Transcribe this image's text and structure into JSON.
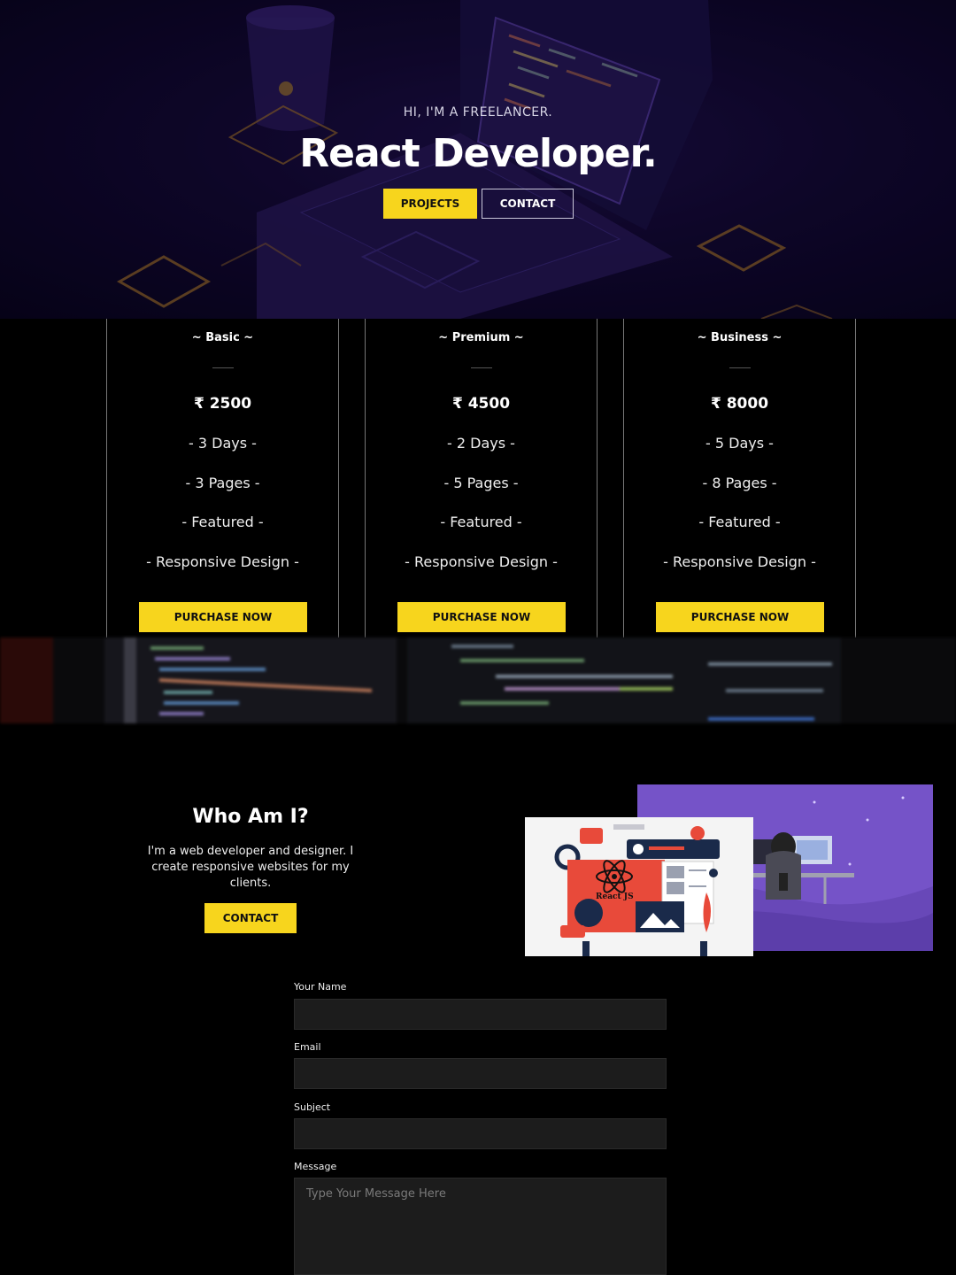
{
  "hero": {
    "eyebrow": "HI, I'M A FREELANCER.",
    "title": "React Developer.",
    "projects_label": "PROJECTS",
    "contact_label": "CONTACT"
  },
  "pricing": {
    "plans": [
      {
        "name": "~ Basic ~",
        "price": "₹ 2500",
        "features": [
          "- 3 Days -",
          "- 3 Pages -",
          "- Featured -",
          "- Responsive Design -"
        ],
        "cta": "PURCHASE NOW"
      },
      {
        "name": "~ Premium ~",
        "price": "₹ 4500",
        "features": [
          "- 2 Days -",
          "- 5 Pages -",
          "- Featured -",
          "- Responsive Design -"
        ],
        "cta": "PURCHASE NOW"
      },
      {
        "name": "~ Business ~",
        "price": "₹ 8000",
        "features": [
          "- 5 Days -",
          "- 8 Pages -",
          "- Featured -",
          "- Responsive Design -"
        ],
        "cta": "PURCHASE NOW"
      }
    ]
  },
  "about": {
    "title": "Who Am I?",
    "text": "I'm a web developer and designer. I create responsive websites for my clients.",
    "contact_label": "CONTACT",
    "illustration_label": "React JS"
  },
  "form": {
    "name_label": "Your Name",
    "name_value": "",
    "email_label": "Email",
    "email_value": "",
    "subject_label": "Subject",
    "subject_value": "",
    "message_label": "Message",
    "message_placeholder": "Type Your Message Here"
  },
  "colors": {
    "accent": "#f7d51d",
    "background": "#000000",
    "hero_bg": "#120832",
    "input_bg": "#1c1c1c",
    "illustration_purple": "#7553c8"
  }
}
